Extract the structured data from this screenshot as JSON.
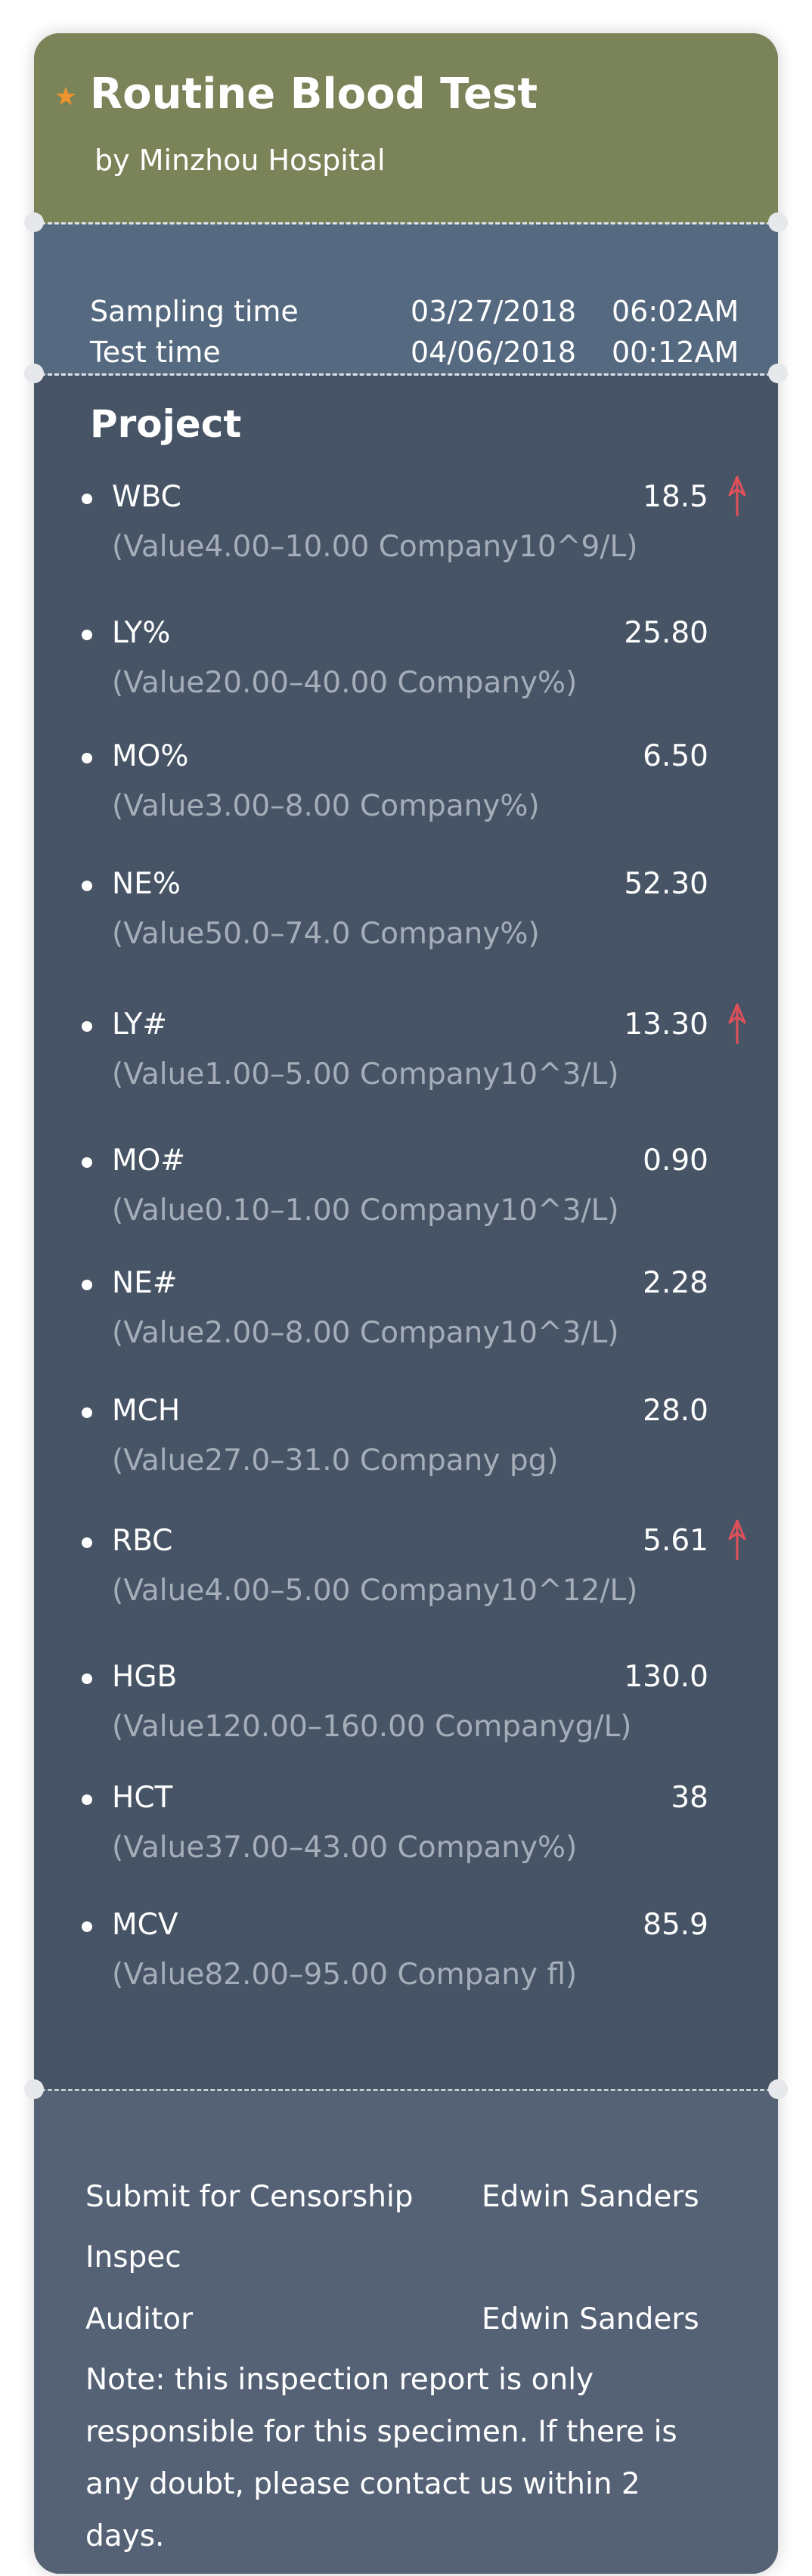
{
  "header": {
    "title": "Routine Blood Test",
    "subtitle": "by Minzhou Hospital",
    "star_icon": "star-icon"
  },
  "times": {
    "sampling_label": "Sampling time",
    "sampling_date": "03/27/2018",
    "sampling_time": "06:02AM",
    "test_label": "Test time",
    "test_date": "04/06/2018",
    "test_time": "00:12AM"
  },
  "project": {
    "title": "Project",
    "items": [
      {
        "name": "WBC",
        "value": "18.5",
        "range": "(Value4.00–10.00 Company10^9/L)",
        "high": true
      },
      {
        "name": "LY%",
        "value": "25.80",
        "range": "(Value20.00–40.00 Company%)",
        "high": false
      },
      {
        "name": "MO%",
        "value": "6.50",
        "range": "(Value3.00–8.00 Company%)",
        "high": false
      },
      {
        "name": "NE%",
        "value": "52.30",
        "range": "(Value50.0–74.0 Company%)",
        "high": false
      },
      {
        "name": "LY#",
        "value": "13.30",
        "range": "(Value1.00–5.00 Company10^3/L)",
        "high": true
      },
      {
        "name": "MO#",
        "value": "0.90",
        "range": "(Value0.10–1.00 Company10^3/L)",
        "high": false
      },
      {
        "name": "NE#",
        "value": "2.28",
        "range": "(Value2.00–8.00 Company10^3/L)",
        "high": false
      },
      {
        "name": "MCH",
        "value": "28.0",
        "range": "(Value27.0–31.0 Company pg)",
        "high": false
      },
      {
        "name": "RBC",
        "value": "5.61",
        "range": "(Value4.00–5.00 Company10^12/L)",
        "high": true
      },
      {
        "name": "HGB",
        "value": "130.0",
        "range": "(Value120.00–160.00 Companyg/L)",
        "high": false
      },
      {
        "name": "HCT",
        "value": "38",
        "range": "(Value37.00–43.00 Company%)",
        "high": false
      },
      {
        "name": "MCV",
        "value": "85.9",
        "range": "(Value82.00–95.00 Company fl)",
        "high": false
      }
    ]
  },
  "footer": {
    "submit_label": "Submit for Censorship",
    "submit_value": "Edwin Sanders",
    "inspec_label": "Inspec",
    "auditor_label": "Auditor",
    "auditor_value": "Edwin Sanders",
    "note": "Note: this inspection report is only responsible for this specimen. If there is any doubt, please contact us within 2 days."
  },
  "colors": {
    "header_bg": "#7b8458",
    "times_bg": "#556a80",
    "body_bg": "#465466",
    "footer_bg": "#556275",
    "star": "#f0922d",
    "high_arrow": "#e0505a",
    "range_text": "#a5adb8"
  }
}
